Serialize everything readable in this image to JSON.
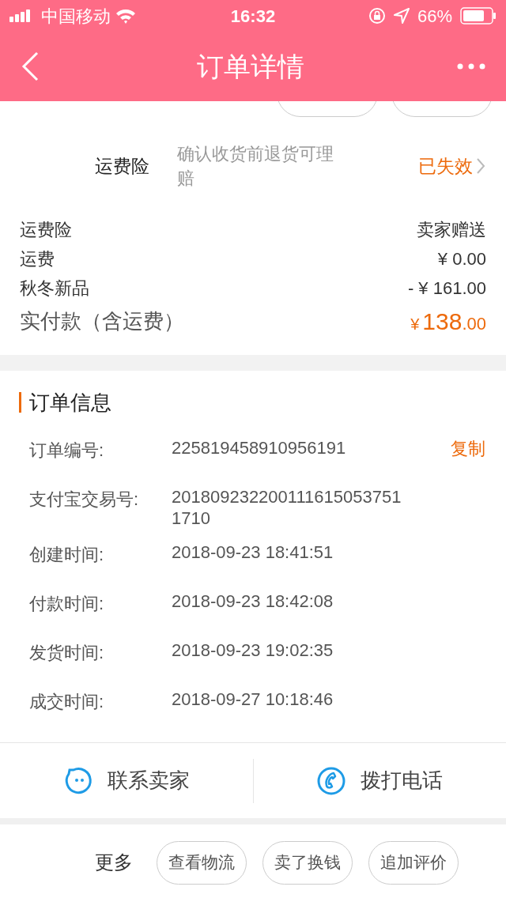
{
  "status_bar": {
    "carrier": "中国移动",
    "time": "16:32",
    "battery": "66%"
  },
  "nav": {
    "title": "订单详情"
  },
  "insurance": {
    "label": "运费险",
    "description": "确认收货前退货可理赔",
    "status": "已失效"
  },
  "fees": [
    {
      "label": "运费险",
      "value": "卖家赠送"
    },
    {
      "label": "运费",
      "value": "¥ 0.00"
    },
    {
      "label": "秋冬新品",
      "value": "- ¥ 161.00"
    }
  ],
  "total": {
    "label": "实付款（含运费）",
    "currency": "¥",
    "integer": "138",
    "decimal": ".00"
  },
  "order_info": {
    "title": "订单信息",
    "copy": "复制",
    "rows": [
      {
        "label": "订单编号:",
        "value": "225819458910956191"
      },
      {
        "label": "支付宝交易号:",
        "value": "2018092322001116150537511710"
      },
      {
        "label": "创建时间:",
        "value": "2018-09-23 18:41:51"
      },
      {
        "label": "付款时间:",
        "value": "2018-09-23 18:42:08"
      },
      {
        "label": "发货时间:",
        "value": "2018-09-23 19:02:35"
      },
      {
        "label": "成交时间:",
        "value": "2018-09-27 10:18:46"
      }
    ]
  },
  "contact": [
    {
      "kind": "chat",
      "label": "联系卖家"
    },
    {
      "kind": "phone",
      "label": "拨打电话"
    }
  ],
  "more": {
    "label": "更多",
    "buttons": [
      "查看物流",
      "卖了换钱",
      "追加评价"
    ]
  }
}
